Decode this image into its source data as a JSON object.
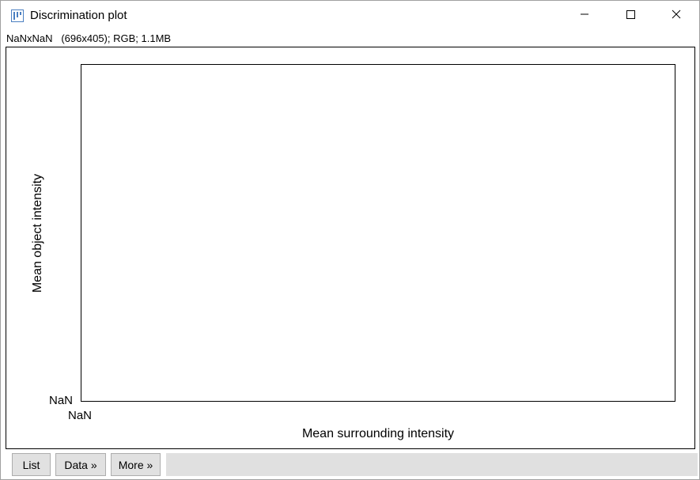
{
  "window": {
    "title": "Discrimination plot",
    "icon": "imagej-app-icon",
    "controls": [
      "minimize-icon",
      "maximize-icon",
      "close-icon"
    ]
  },
  "info": {
    "text": "NaNxNaN   (696x405); RGB; 1.1MB"
  },
  "plot": {
    "y_axis_label": "Mean object intensity",
    "x_axis_label": "Mean surrounding intensity",
    "y_min_tick": "NaN",
    "x_min_tick": "NaN"
  },
  "buttons": {
    "list": "List",
    "data": "Data »",
    "more": "More »"
  },
  "colors": {
    "button_bg": "#e1e1e1",
    "status_bg": "#e0e0e0",
    "icon_blue": "#4a7fc1"
  }
}
